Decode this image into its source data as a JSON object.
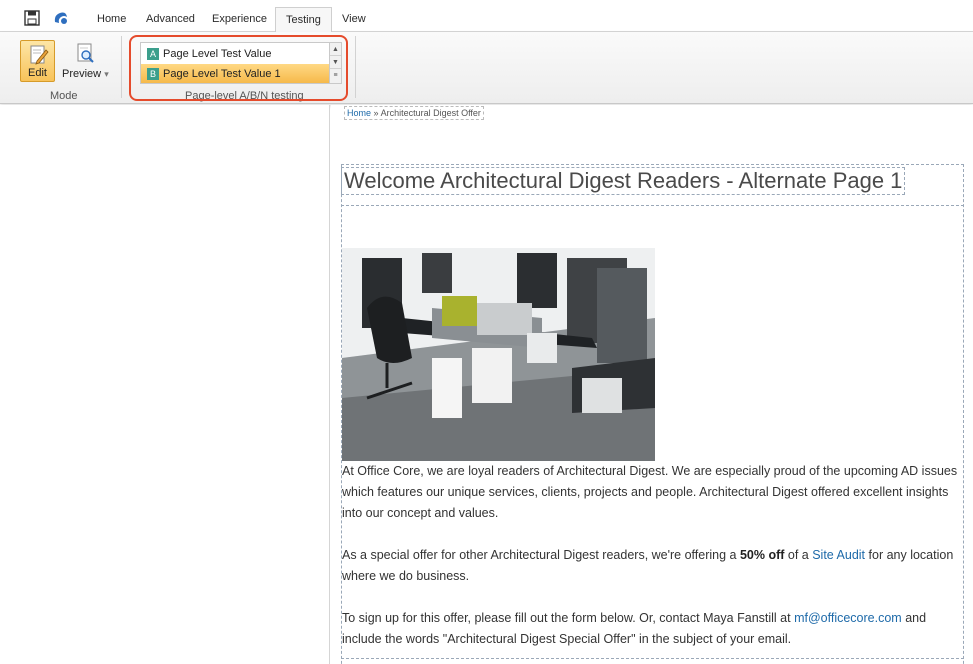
{
  "tabs": [
    {
      "label": "Home"
    },
    {
      "label": "Advanced"
    },
    {
      "label": "Experience"
    },
    {
      "label": "Testing",
      "active": true
    },
    {
      "label": "View"
    }
  ],
  "mode_group": {
    "label": "Mode",
    "edit_label": "Edit",
    "preview_label": "Preview"
  },
  "testing_group": {
    "label": "Page-level A/B/N testing",
    "variants": [
      {
        "letter": "A",
        "name": "Page Level Test Value"
      },
      {
        "letter": "B",
        "name": "Page Level Test Value 1",
        "selected": true
      }
    ]
  },
  "breadcrumb": {
    "home": "Home",
    "separator": "»",
    "current": "Architectural Digest Offer"
  },
  "page": {
    "heading": "Welcome Architectural Digest Readers - Alternate Page 1",
    "para1": "At Office Core, we are loyal readers of Architectural Digest. We are especially proud of the upcoming AD issues which features our unique services, clients, projects and people.  Architectural Digest offered excellent insights into our concept and values.",
    "para2_pre": "As a special offer for other Architectural Digest readers, we're offering a ",
    "para2_bold": "50% off",
    "para2_mid": " of a ",
    "para2_link": "Site Audit",
    "para2_post": " for any location where we do business.",
    "para3_pre": "To sign up for this offer, please fill out the form below. Or, contact Maya Fanstill at  ",
    "para3_link": "mf@officecore.com",
    "para3_post": " and include the words \"Architectural Digest Special Offer\" in the subject of your email."
  },
  "colors": {
    "accent_highlight": "#e54b2c",
    "selected_row": "#f6b94a",
    "variant_badge": "#3c9f8c",
    "link": "#1e6aa9"
  }
}
